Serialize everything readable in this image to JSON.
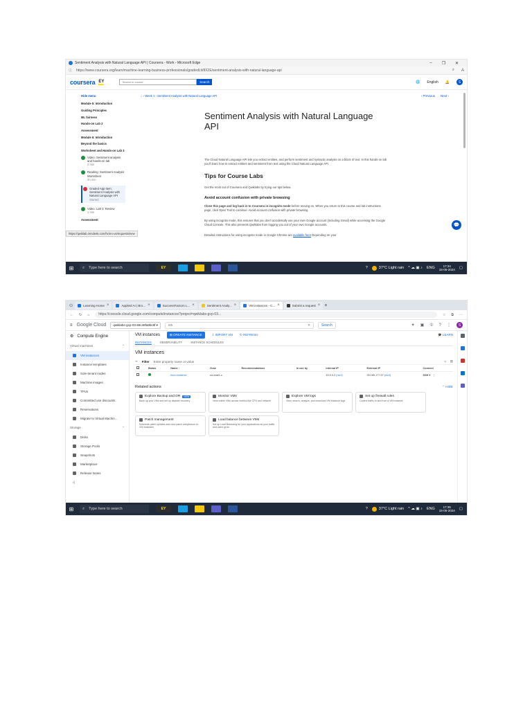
{
  "shot1": {
    "window_title": "Sentiment Analysis with Natural Language API | Coursera - Work - Microsoft Edge",
    "url": "https://www.coursera.org/learn/machine-learning-business-professionals/gradedLti/8X2E/sentiment-analysis-with-natural-language-api",
    "brand": "coursera",
    "partner": "EY",
    "search_placeholder": "Search in course",
    "search_button": "Search",
    "language": "English",
    "avatar": "S",
    "sidebar": {
      "hide_menu": "Hide menu",
      "modules": [
        "Module 5: Introduction",
        "Guiding Principles",
        "ML fairness",
        "Hands-on Lab 2",
        "Assessment",
        "Module 6: Introduction",
        "Beyond the basics",
        "Worksheet and Hands-on Lab 3"
      ],
      "lessons": [
        {
          "title": "Video: Sentiment analysis and hands-on lab",
          "meta": "2 min"
        },
        {
          "title": "Reading: Sentiment Analysis Worksheet",
          "meta": "30 min"
        },
        {
          "title": "Graded App Item: Sentiment Analysis with Natural Language API",
          "meta": "Started"
        },
        {
          "title": "Video: Lab 3: Review",
          "meta": "1 min"
        }
      ],
      "last": "Assessment"
    },
    "breadcrumb": [
      "Week 1",
      "Sentiment Analysis with Natural Language API"
    ],
    "previous": "Previous",
    "next": "Next",
    "heading": "Sentiment Analysis with Natural Language API",
    "intro": "The Cloud Natural Language API lets you extract entities, and perform sentiment and syntactic analysis on a block of text. In this hands-on lab you'll learn how to extract entities and sentiment from text using the Cloud Natural Language API.",
    "tips_heading": "Tips for Course Labs",
    "tips_text": "Get the most out of Coursera and Qwiklabs by trying our tips below.",
    "avoid_heading": "Avoid account confusion with private browsing",
    "avoid_bold": "Close this page and log back in to Coursera in incognito mode",
    "avoid_text": "before moving on. When you return to this course and lab instructions page, click Open Tool to continue. Avoid account confusion with private browsing.",
    "incognito_text": "By using incognito mode, this ensures that you don't accidentally use your own Google account (including Gmail) while accessing the Google Cloud Console. This also prevents Qwiklabs from logging you out of your own Google accounts.",
    "detailed_text": "Detailed instructions for using incognito mode in Google Chrome are",
    "detailed_link": "available here",
    "detailed_tail": "Depending on your",
    "status_url": "https://qwiklab.zendesk.com/hc/en-us/requests/new",
    "taskbar": {
      "search": "Type here to search",
      "weather": "37°C Light rain",
      "lang": "ENG",
      "time": "17:34",
      "date": "15-05-2024",
      "ey": "EY"
    }
  },
  "shot2": {
    "tabs": [
      "Learning Home",
      "Applied AI | Bro...",
      "SuccessFactors L...",
      "Sentiment Analy...",
      "VM instances - C...",
      "Submit a request"
    ],
    "url": "https://console.cloud.google.com/compute/instances?project=qwiklabs-gcp-03...",
    "logo": "Google Cloud",
    "project": "qwiklabs-gcp-03-66c48fa9bc8f",
    "search_value": "nth",
    "search_button": "Search",
    "avatar": "S",
    "sidebar": {
      "product": "Compute Engine",
      "group1": "Virtual machines",
      "items1": [
        "VM instances",
        "Instance templates",
        "Sole-tenant nodes",
        "Machine images",
        "TPUs",
        "Committed use discounts",
        "Reservations",
        "Migrate to Virtual Machin..."
      ],
      "group2": "Storage",
      "items2": [
        "Disks",
        "Storage Pools",
        "Snapshots",
        "Marketplace",
        "Release Notes"
      ]
    },
    "page_title": "VM instances",
    "create_instance": "CREATE INSTANCE",
    "import_vm": "IMPORT VM",
    "refresh": "REFRESH",
    "learn": "LEARN",
    "subtabs": [
      "INSTANCES",
      "OBSERVABILITY",
      "INSTANCE SCHEDULES"
    ],
    "section_title": "VM instances",
    "filter_label": "Filter",
    "filter_placeholder": "Enter property name or value",
    "columns": [
      "Status",
      "Name",
      "Zone",
      "Recommendations",
      "In use by",
      "Internal IP",
      "External IP",
      "Connect"
    ],
    "row": {
      "name": "linux-instance",
      "zone": "us-east1-c",
      "internal_ip": "10.0.0.2",
      "internal_nic": "(nic0)",
      "external_ip": "35.185.177.57",
      "external_nic": "(nic0)",
      "connect": "SSH"
    },
    "related_title": "Related actions",
    "hide": "HIDE",
    "new_badge": "NEW",
    "cards": [
      {
        "title": "Explore Backup and DR",
        "desc": "Back up your VMs and set up disaster recovery"
      },
      {
        "title": "Monitor VMs",
        "desc": "View outlier VMs across metrics like CPU and network"
      },
      {
        "title": "Explore VM logs",
        "desc": "View, search, analyze, and download VM instance logs"
      },
      {
        "title": "Set up firewall rules",
        "desc": "Control traffic to and from a VM instance"
      },
      {
        "title": "Patch management",
        "desc": "Schedule patch updates and view patch compliance on VM instances"
      },
      {
        "title": "Load balance between VMs",
        "desc": "Set up Load Balancing for your applications as your traffic and users grow"
      }
    ],
    "taskbar": {
      "search": "Type here to search",
      "weather": "37°C Light rain",
      "lang": "ENG",
      "time": "17:35",
      "date": "15-05-2024",
      "ey": "EY"
    }
  }
}
